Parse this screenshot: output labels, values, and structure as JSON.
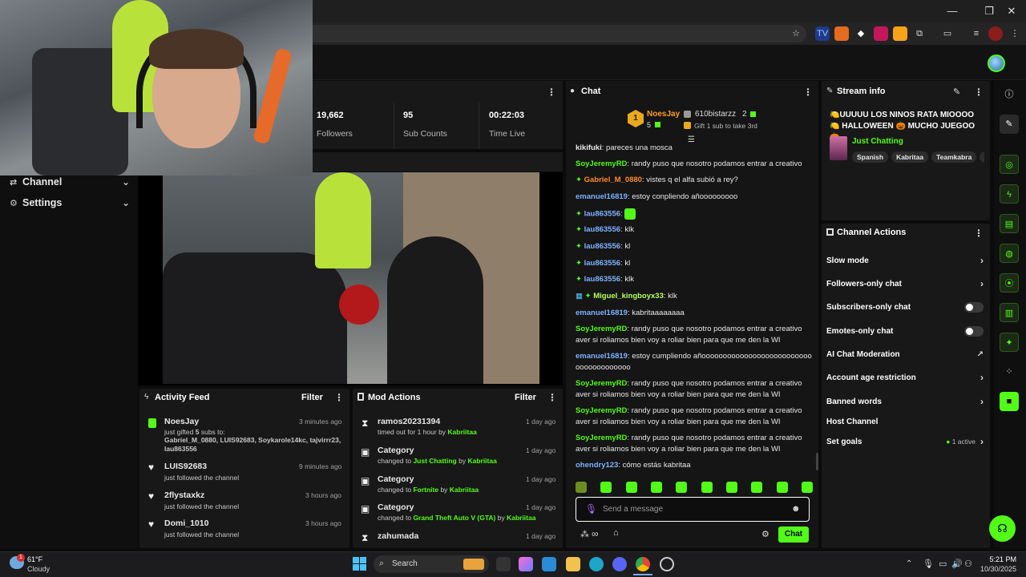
{
  "window_controls": {
    "minimize": "—",
    "maximize": "❐",
    "close": "✕"
  },
  "webcam": {},
  "sidebar": {
    "items": [
      {
        "label": "Channel",
        "icon": "channel-icon"
      },
      {
        "label": "Settings",
        "icon": "gear-icon"
      }
    ]
  },
  "stats": [
    {
      "value": "19,662",
      "label": "Followers"
    },
    {
      "value": "95",
      "label": "Sub Counts"
    },
    {
      "value": "00:22:03",
      "label": "Time Live"
    }
  ],
  "activity_feed": {
    "title": "Activity Feed",
    "filter_label": "Filter",
    "items": [
      {
        "name": "NoesJay",
        "time": "3 minutes ago",
        "action_prefix": "just gifted ",
        "action_count": "5",
        "action_suffix": " subs to:",
        "recipients": "Gabriel_M_0880, LUIS92683, Soykarole14kc, tajvirrr23, lau863556",
        "icon": "gift-icon"
      },
      {
        "name": "LUIS92683",
        "time": "9 minutes ago",
        "action": "just followed the channel",
        "icon": "heart-icon"
      },
      {
        "name": "2flystaxkz",
        "time": "3 hours ago",
        "action": "just followed the channel",
        "icon": "heart-icon"
      },
      {
        "name": "Domi_1010",
        "time": "3 hours ago",
        "action": "just followed the channel",
        "icon": "heart-icon"
      }
    ]
  },
  "mod_actions": {
    "title": "Mod Actions",
    "filter_label": "Filter",
    "items": [
      {
        "name": "ramos20231394",
        "time": "1 day ago",
        "prefix": "timed out for 1 hour by ",
        "target": "",
        "by": "Kabriitaa",
        "icon": "hourglass-icon"
      },
      {
        "name": "Category",
        "time": "1 day ago",
        "prefix": "changed to ",
        "target": "Just Chatting",
        "by": "Kabriitaa",
        "icon": "category-icon"
      },
      {
        "name": "Category",
        "time": "1 day ago",
        "prefix": "changed to ",
        "target": "Fortnite",
        "by": "Kabriitaa",
        "icon": "category-icon"
      },
      {
        "name": "Category",
        "time": "1 day ago",
        "prefix": "changed to ",
        "target": "Grand Theft Auto V (GTA)",
        "by": "Kabriitaa",
        "icon": "category-icon"
      },
      {
        "name": "zahumada",
        "time": "1 day ago",
        "prefix": "",
        "target": "",
        "by": "",
        "icon": "hourglass-icon"
      }
    ]
  },
  "chat": {
    "title": "Chat",
    "leaderboard": {
      "first_rank": "1",
      "first_name": "NoesJay",
      "first_count": "5",
      "second_name": "610bistarzz",
      "second_count": "2",
      "gift_hint": "Gift 1 sub to take 3rd"
    },
    "messages": [
      {
        "user": "kikifuki",
        "color": "white",
        "text": "pareces una mosca"
      },
      {
        "user": "SoyJeremyRD",
        "color": "green",
        "text": "randy puso que nosotro podamos entrar a creativo"
      },
      {
        "user": "Gabriel_M_0880",
        "color": "orange",
        "text": "vistes q el alfa subió a rey?",
        "badge": true
      },
      {
        "user": "emanuel16819",
        "color": "blue",
        "text": "estoy conpliendo añooooooooo"
      },
      {
        "user": "lau863556",
        "color": "blue",
        "text": "",
        "badge": true,
        "emote": true
      },
      {
        "user": "lau863556",
        "color": "blue",
        "text": "klk",
        "badge": true
      },
      {
        "user": "lau863556",
        "color": "blue",
        "text": "kl",
        "badge": true
      },
      {
        "user": "lau863556",
        "color": "blue",
        "text": "kl",
        "badge": true
      },
      {
        "user": "lau863556",
        "color": "blue",
        "text": "klk",
        "badge": true
      },
      {
        "user": "Miguel_kingboyx33",
        "color": "lime",
        "text": "klk",
        "badge": true
      },
      {
        "user": "emanuel16819",
        "color": "blue",
        "text": "kabritaaaaaaaa"
      },
      {
        "user": "SoyJeremyRD",
        "color": "green",
        "text": "randy puso que nosotro podamos entrar a creativo aver si roliamos bien voy a roliar bien para que me den la WI"
      },
      {
        "user": "emanuel16819",
        "color": "blue",
        "text": "estoy cumpliendo añooooooooooooooooooooooooooooooooooooooo"
      },
      {
        "user": "SoyJeremyRD",
        "color": "green",
        "text": "randy puso que nosotro podamos entrar a creativo aver si roliamos bien voy a roliar bien para que me den la WI"
      },
      {
        "user": "SoyJeremyRD",
        "color": "green",
        "text": "randy puso que nosotro podamos entrar a creativo aver si roliamos bien voy a roliar bien para que me den la WI"
      },
      {
        "user": "SoyJeremyRD",
        "color": "green",
        "text": "randy puso que nosotro podamos entrar a creativo aver si roliamos bien voy a roliar bien para que me den la WI"
      },
      {
        "user": "ohendry123",
        "color": "blue",
        "text": "cómo estás kabritaa"
      }
    ],
    "input_placeholder": "Send a message",
    "send_label": "Chat"
  },
  "stream_info": {
    "title": "Stream info",
    "stream_title": "🍋UUUUU LOS NINOS RATA MIOOOO 🍋 HALLOWEEN 🎃 MUCHO JUEGOO🎃...",
    "category": "Just Chatting",
    "tags": [
      "Spanish",
      "Kabritaa",
      "Teamkabra"
    ]
  },
  "channel_actions": {
    "title": "Channel Actions",
    "rows": [
      {
        "label": "Slow mode",
        "control": "chevron"
      },
      {
        "label": "Followers-only chat",
        "control": "chevron"
      },
      {
        "label": "Subscribers-only chat",
        "control": "toggle"
      },
      {
        "label": "Emotes-only chat",
        "control": "toggle"
      },
      {
        "label": "AI Chat Moderation",
        "control": "external"
      },
      {
        "label": "Account age restriction",
        "control": "chevron"
      },
      {
        "label": "Banned words",
        "control": "chevron"
      },
      {
        "label": "Host Channel",
        "control": "none"
      },
      {
        "label": "Set goals",
        "control": "chevron",
        "status": "1 active"
      }
    ]
  },
  "taskbar": {
    "weather_temp": "61°F",
    "weather_desc": "Cloudy",
    "weather_badge": "1",
    "search_placeholder": "Search",
    "time": "5:21 PM",
    "date": "10/30/2025"
  },
  "colors": {
    "accent": "#53fc18",
    "panel": "#181818",
    "background": "#0b0b0b"
  }
}
